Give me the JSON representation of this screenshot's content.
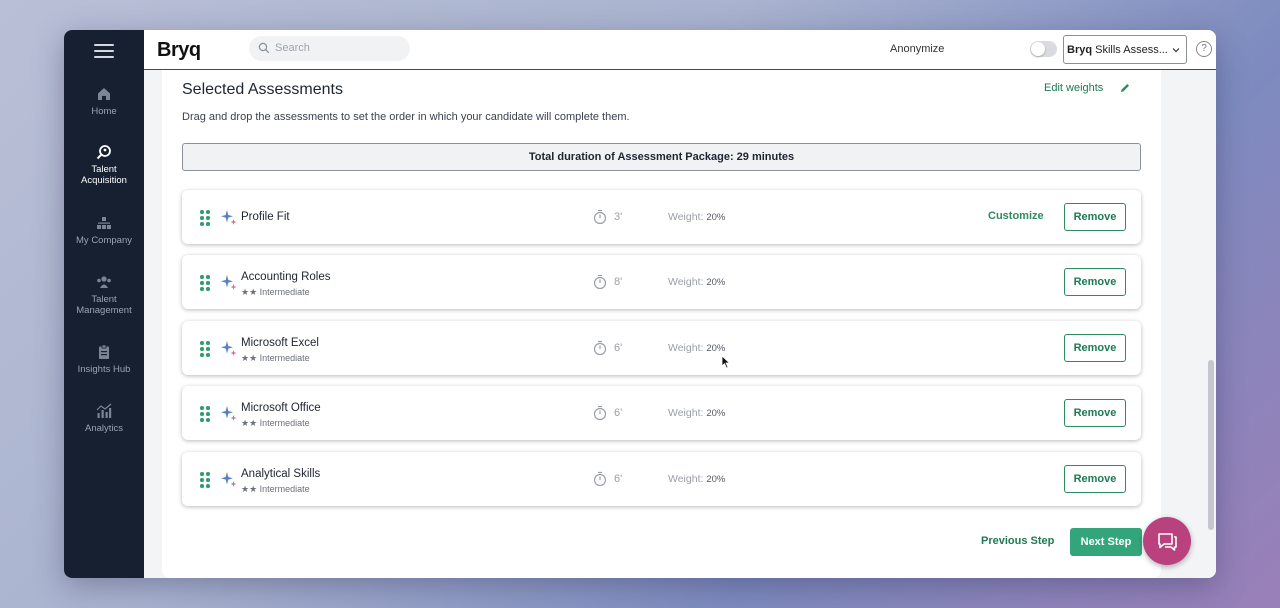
{
  "sidebar": {
    "items": [
      {
        "label": "Home",
        "icon": "home-icon"
      },
      {
        "label": "Talent Acquisition",
        "icon": "talent-acquisition-icon",
        "active": true
      },
      {
        "label": "My Company",
        "icon": "org-chart-icon"
      },
      {
        "label": "Talent Management",
        "icon": "people-icon"
      },
      {
        "label": "Insights Hub",
        "icon": "clipboard-icon"
      },
      {
        "label": "Analytics",
        "icon": "analytics-icon"
      }
    ]
  },
  "topbar": {
    "logo": "Bryq",
    "search_placeholder": "Search",
    "anonymize_label": "Anonymize",
    "package_select_brand": "Bryq",
    "package_select_value": "Skills Assess...",
    "help_label": "?"
  },
  "section": {
    "title": "Selected Assessments",
    "edit_weights": "Edit weights",
    "subtitle": "Drag and drop the assessments to set the order in which your candidate will complete them.",
    "total_duration": "Total duration of Assessment Package: 29 minutes"
  },
  "assessments": [
    {
      "name": "Profile Fit",
      "level": "",
      "duration": "3'",
      "weight_label": "Weight:",
      "weight": "20%",
      "customize": "Customize",
      "remove": "Remove"
    },
    {
      "name": "Accounting Roles",
      "level": "★★ Intermediate",
      "duration": "8'",
      "weight_label": "Weight:",
      "weight": "20%",
      "customize": "",
      "remove": "Remove"
    },
    {
      "name": "Microsoft Excel",
      "level": "★★ Intermediate",
      "duration": "6'",
      "weight_label": "Weight:",
      "weight": "20%",
      "customize": "",
      "remove": "Remove"
    },
    {
      "name": "Microsoft Office",
      "level": "★★ Intermediate",
      "duration": "6'",
      "weight_label": "Weight:",
      "weight": "20%",
      "customize": "",
      "remove": "Remove"
    },
    {
      "name": "Analytical Skills",
      "level": "★★ Intermediate",
      "duration": "6'",
      "weight_label": "Weight:",
      "weight": "20%",
      "customize": "",
      "remove": "Remove"
    }
  ],
  "footer": {
    "previous": "Previous Step",
    "next": "Next Step"
  },
  "colors": {
    "accent": "#2f8a5f",
    "sidebar_bg": "#162030",
    "chat_bubble": "#b8417e"
  }
}
